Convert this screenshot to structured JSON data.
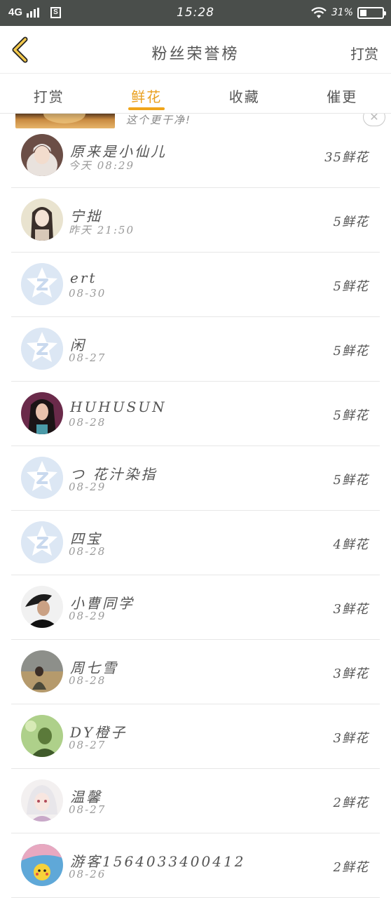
{
  "status_bar": {
    "network": "4G",
    "sim_label": "S",
    "time": "15:28",
    "battery_percent": "31%",
    "battery_level": 0.31
  },
  "header": {
    "title": "粉丝荣誉榜",
    "action_label": "打赏"
  },
  "tabs": [
    {
      "label": "打赏",
      "active": false
    },
    {
      "label": "鲜花",
      "active": true
    },
    {
      "label": "收藏",
      "active": false
    },
    {
      "label": "催更",
      "active": false
    }
  ],
  "colors": {
    "accent": "#f0a51a",
    "status_bar": "#4a4e4b"
  },
  "ad": {
    "text": "这个更干净!",
    "close_icon": "close-icon"
  },
  "supporters": [
    {
      "name": "原来是小仙儿",
      "time": "今天 08:29",
      "count": "35鲜花",
      "avatar": "photo-girl-white-hood"
    },
    {
      "name": "宁拙",
      "time": "昨天 21:50",
      "count": "5鲜花",
      "avatar": "illustration-long-hair"
    },
    {
      "name": "ert",
      "time": "08-30",
      "count": "5鲜花",
      "avatar": "default-qq-icon"
    },
    {
      "name": "闲",
      "time": "08-27",
      "count": "5鲜花",
      "avatar": "default-qq-icon"
    },
    {
      "name": "HUHUSUN",
      "time": "08-28",
      "count": "5鲜花",
      "avatar": "photo-woman-dark-hair"
    },
    {
      "name": "つ 花汁染指",
      "time": "08-29",
      "count": "5鲜花",
      "avatar": "default-qq-icon"
    },
    {
      "name": "四宝",
      "time": "08-28",
      "count": "4鲜花",
      "avatar": "default-qq-icon"
    },
    {
      "name": "小曹同学",
      "time": "08-29",
      "count": "3鲜花",
      "avatar": "photo-man-dark"
    },
    {
      "name": "周七雪",
      "time": "08-28",
      "count": "3鲜花",
      "avatar": "photo-landscape-person"
    },
    {
      "name": "DY橙子",
      "time": "08-27",
      "count": "3鲜花",
      "avatar": "photo-green-portrait"
    },
    {
      "name": "温馨",
      "time": "08-27",
      "count": "2鲜花",
      "avatar": "illustration-white-hair"
    },
    {
      "name": "游客1564033400412",
      "time": "08-26",
      "count": "2鲜花",
      "avatar": "photo-pikachu"
    }
  ]
}
